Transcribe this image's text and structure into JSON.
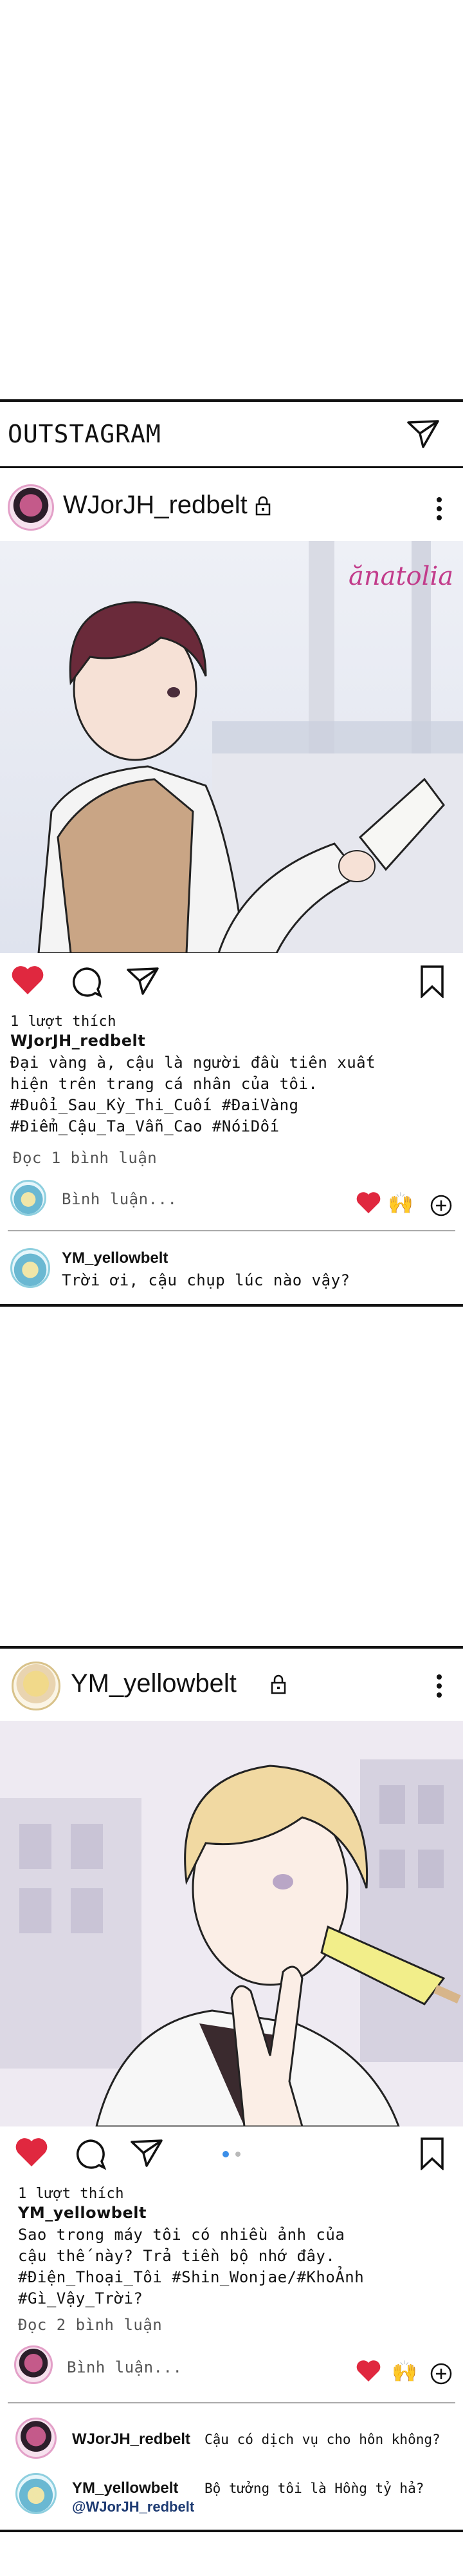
{
  "app": {
    "title": "OUTSTAGRAM"
  },
  "posts": [
    {
      "username": "WJorJH_redbelt",
      "watermark": "ănatolia",
      "likes": "1 lượt thích",
      "caption_user": "WJorJH_redbelt",
      "caption_lines": [
        "Đại vàng à, cậu là người đầu tiên xuất",
        "hiện trên trang cá nhân của tôi.",
        "#Đuổi_Sau_Kỳ_Thi_Cuối #ĐaiVàng",
        "#Điểm_Cậu_Ta_Vẫn_Cao #NóiDối"
      ],
      "view_comments": "Đọc 1 bình luận",
      "comment_placeholder": "Bình luận...",
      "comments": [
        {
          "user": "YM_yellowbelt",
          "text": "Trời ơi, cậu chụp lúc nào vậy?"
        }
      ]
    },
    {
      "username": "YM_yellowbelt",
      "likes": "1 lượt thích",
      "caption_user": "YM_yellowbelt",
      "caption_lines": [
        "Sao trong máy tôi có nhiều ảnh của",
        "cậu thế này? Trả tiền bộ nhớ đây.",
        "#Điện_Thoại_Tôi #Shin_Wonjae/#KhoẢnh",
        "#Gì_Vậy_Trời?"
      ],
      "view_comments": "Đọc 2 bình luận",
      "comment_placeholder": "Bình luận...",
      "comments": [
        {
          "user": "WJorJH_redbelt",
          "text": "Cậu có dịch vụ cho hôn không?"
        },
        {
          "user": "YM_yellowbelt",
          "text": "Bộ tưởng tôi là Hồng tỷ hả?",
          "mention": "@WJorJH_redbelt"
        }
      ]
    }
  ],
  "icons": {
    "heart_color": "#e0283f",
    "reaction_emoji": "🙌"
  }
}
